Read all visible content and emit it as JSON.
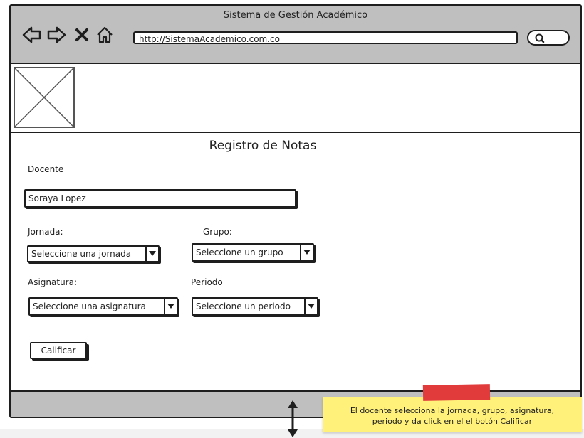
{
  "window": {
    "title": "Sistema de Gestión Académico"
  },
  "browser": {
    "url": "http://SistemaAcademico.com.co",
    "icons": [
      "back-arrow-icon",
      "forward-arrow-icon",
      "close-icon",
      "home-icon",
      "search-icon"
    ]
  },
  "header": {
    "logo": "image-placeholder-icon"
  },
  "form": {
    "title": "Registro de Notas",
    "docente_label": "Docente",
    "docente_value": "Soraya Lopez",
    "jornada_label": "Jornada:",
    "jornada_value": "Seleccione una jornada",
    "grupo_label": "Grupo:",
    "grupo_value": "Seleccione un grupo",
    "asignatura_label": "Asignatura:",
    "asignatura_value": "Seleccione una asignatura",
    "periodo_label": "Periodo",
    "periodo_value": "Seleccione un periodo",
    "submit_label": "Calificar"
  },
  "annotation": {
    "line1": "El docente selecciona la jornada, grupo, asignatura,",
    "line2": "periodo y da click en el el botón Calificar"
  },
  "colors": {
    "chrome": "#bfbfbf",
    "note": "#fff17a",
    "tape": "#e23b3b",
    "stroke": "#1e1e1e"
  }
}
